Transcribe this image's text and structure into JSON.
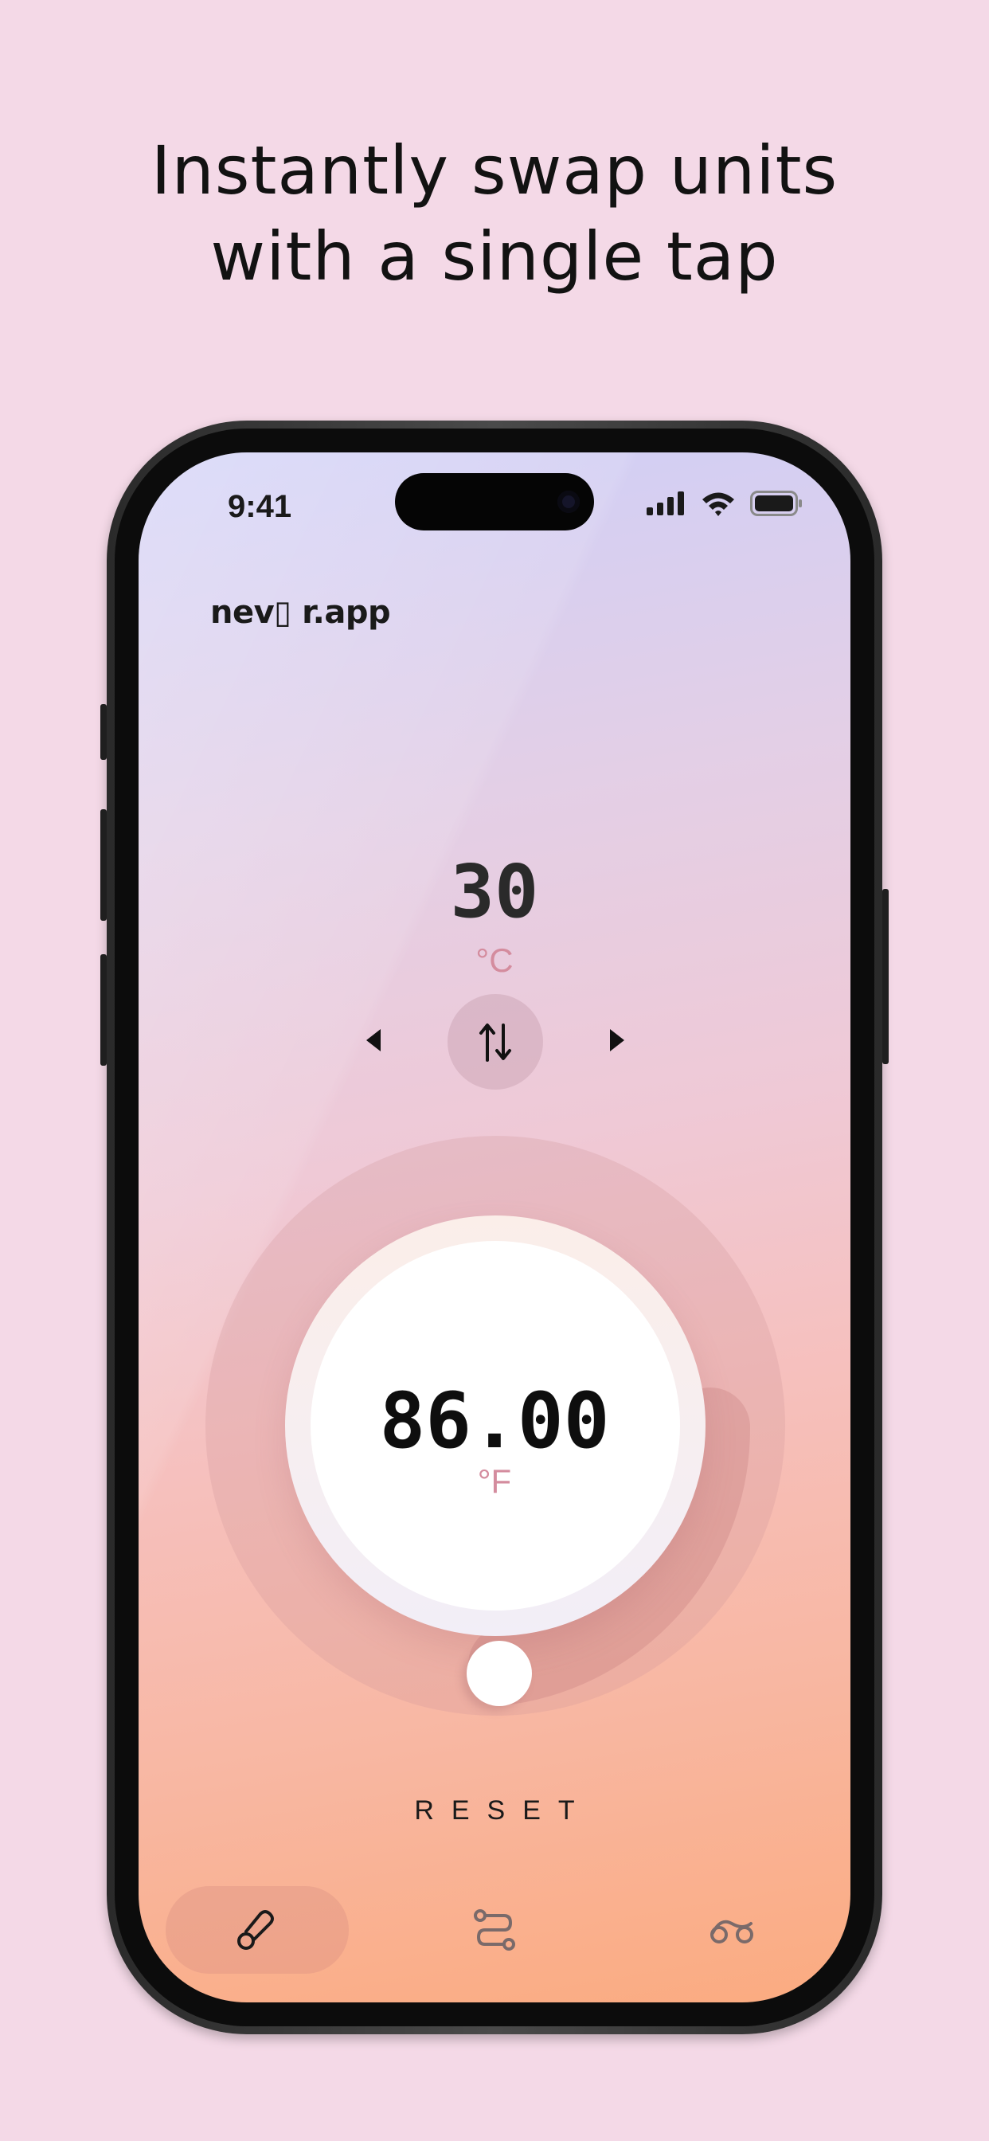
{
  "headline": {
    "line1": "Instantly swap units",
    "line2": "with a single tap"
  },
  "status_bar": {
    "time": "9:41"
  },
  "brand": {
    "name": "nev▯ r.app"
  },
  "converter": {
    "input_value": "30",
    "input_unit": "°C",
    "output_value": "86.00",
    "output_unit": "°F",
    "reset_label": "RESET"
  },
  "tabs": [
    {
      "name": "temperature",
      "icon": "thermometer-icon",
      "active": true
    },
    {
      "name": "distance",
      "icon": "route-icon",
      "active": false
    },
    {
      "name": "weight",
      "icon": "scale-icon",
      "active": false
    }
  ],
  "colors": {
    "background": "#f4d9e7",
    "accent_unit": "#d48c9e",
    "text_dark": "#1a1a1a"
  }
}
